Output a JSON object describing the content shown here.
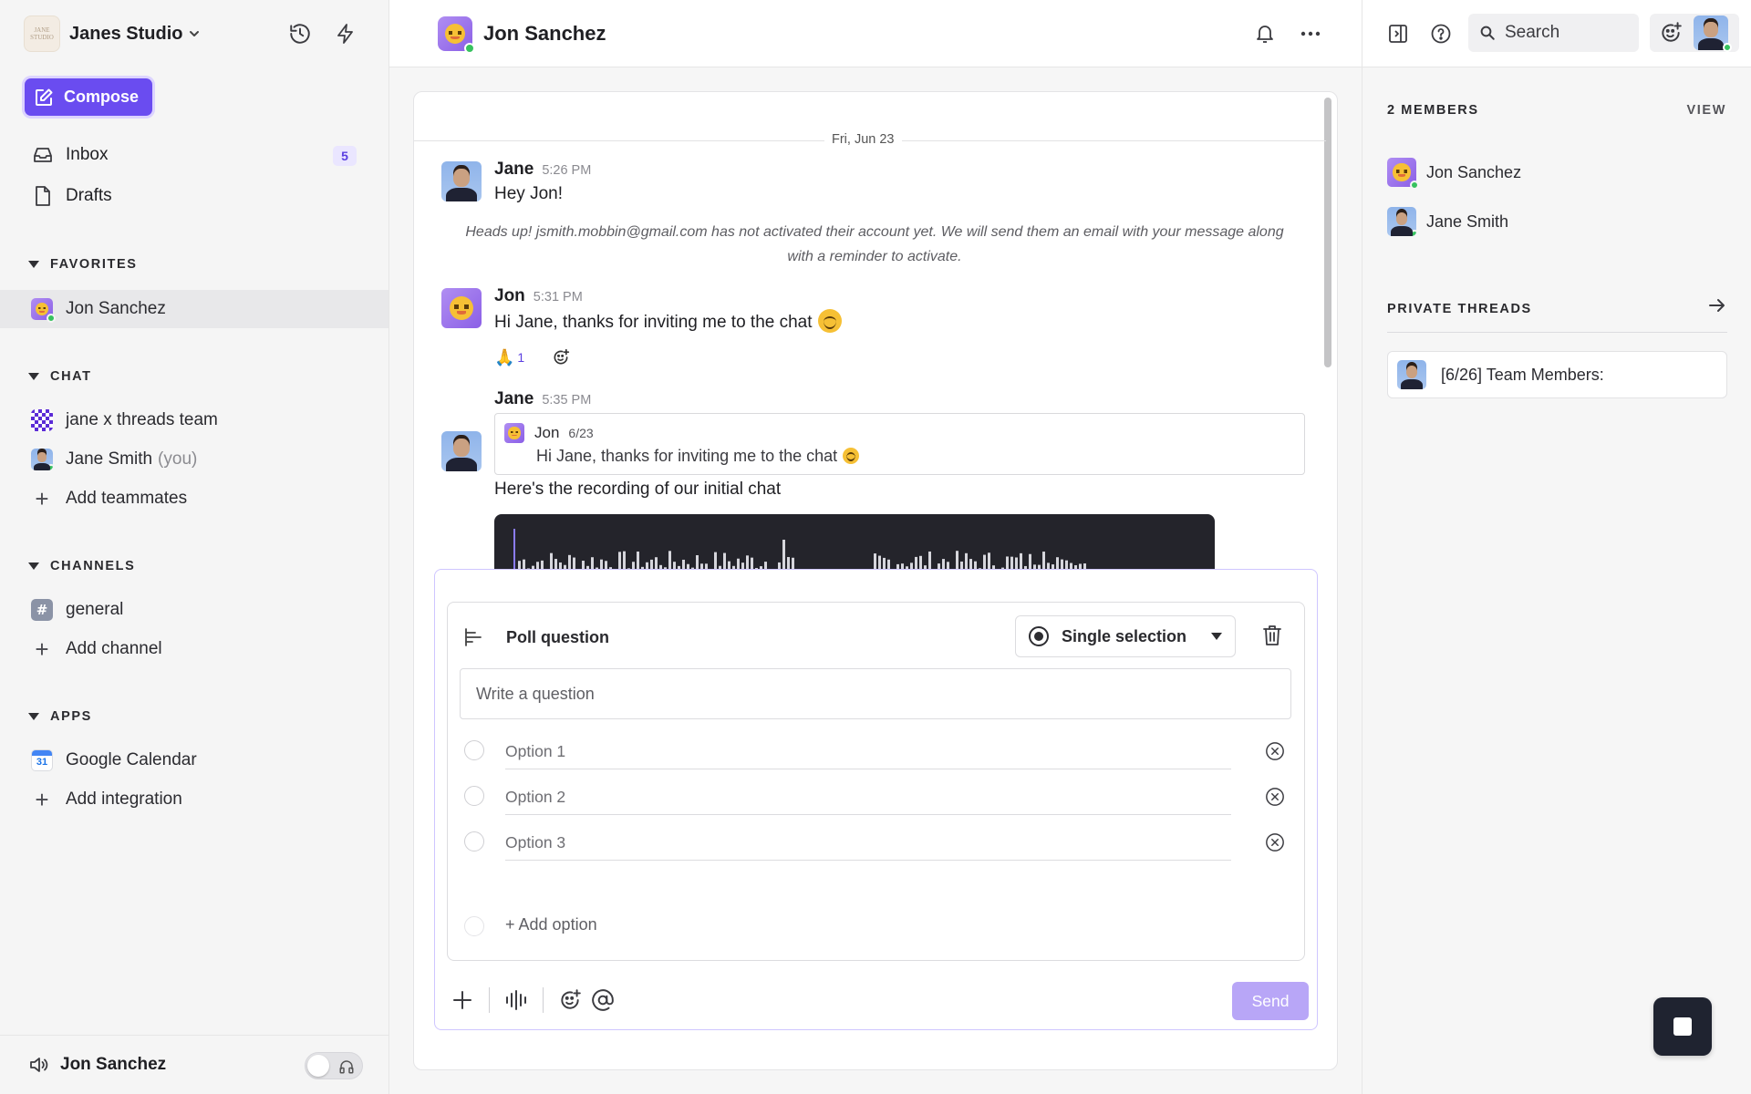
{
  "sidebar": {
    "workspace_name": "Janes Studio",
    "workspace_logo_text": "JANE STUDIO",
    "compose_label": "Compose",
    "nav": [
      {
        "label": "Inbox",
        "count": "5",
        "icon": "inbox-icon"
      },
      {
        "label": "Drafts",
        "icon": "file-icon"
      }
    ],
    "favorites": {
      "title": "FAVORITES",
      "items": [
        {
          "label": "Jon Sanchez",
          "active": true
        }
      ]
    },
    "chat": {
      "title": "CHAT",
      "items": [
        {
          "label": "jane x threads team"
        },
        {
          "label": "Jane Smith",
          "suffix": "(you)"
        },
        {
          "label": "Add teammates"
        }
      ]
    },
    "channels": {
      "title": "CHANNELS",
      "items": [
        {
          "label": "general"
        },
        {
          "label": "Add channel"
        }
      ]
    },
    "apps": {
      "title": "APPS",
      "items": [
        {
          "label": "Google Calendar",
          "icon_text": "31"
        },
        {
          "label": "Add integration"
        }
      ]
    },
    "footer": {
      "label": "Jon Sanchez",
      "toggle_on": false
    }
  },
  "conversation": {
    "title": "Jon Sanchez",
    "date_separator": "Fri, Jun 23",
    "messages": [
      {
        "author": "Jane",
        "time": "5:26 PM",
        "text": "Hey Jon!"
      },
      {
        "notice": "Heads up! jsmith.mobbin@gmail.com has not activated their account yet. We will send them an email with your message along with a reminder to activate."
      },
      {
        "author": "Jon",
        "time": "5:31 PM",
        "text": "Hi Jane, thanks for inviting me to the chat",
        "reaction": {
          "emoji": "🙏",
          "count": "1"
        }
      },
      {
        "author": "Jane",
        "time": "5:35 PM",
        "quote": {
          "author": "Jon",
          "date": "6/23",
          "text": "Hi Jane, thanks for inviting me to the chat"
        },
        "text": "Here's the recording of our initial chat"
      }
    ]
  },
  "poll": {
    "title": "Poll question",
    "selection_mode": "Single selection",
    "question_placeholder": "Write a question",
    "options": [
      {
        "placeholder": "Option 1"
      },
      {
        "placeholder": "Option 2"
      },
      {
        "placeholder": "Option 3"
      }
    ],
    "add_option_label": "+ Add option"
  },
  "composer": {
    "send_label": "Send"
  },
  "right_panel": {
    "search_placeholder": "Search",
    "members_title": "2 MEMBERS",
    "view_label": "VIEW",
    "members": [
      {
        "name": "Jon Sanchez"
      },
      {
        "name": "Jane Smith"
      }
    ],
    "private_threads_title": "PRIVATE THREADS",
    "threads": [
      {
        "title": "[6/26] Team Members:"
      }
    ]
  },
  "colors": {
    "accent": "#6a4cf0",
    "send_disabled": "#b8a6f7",
    "online": "#37c25f",
    "recording_bg": "#24242b"
  }
}
